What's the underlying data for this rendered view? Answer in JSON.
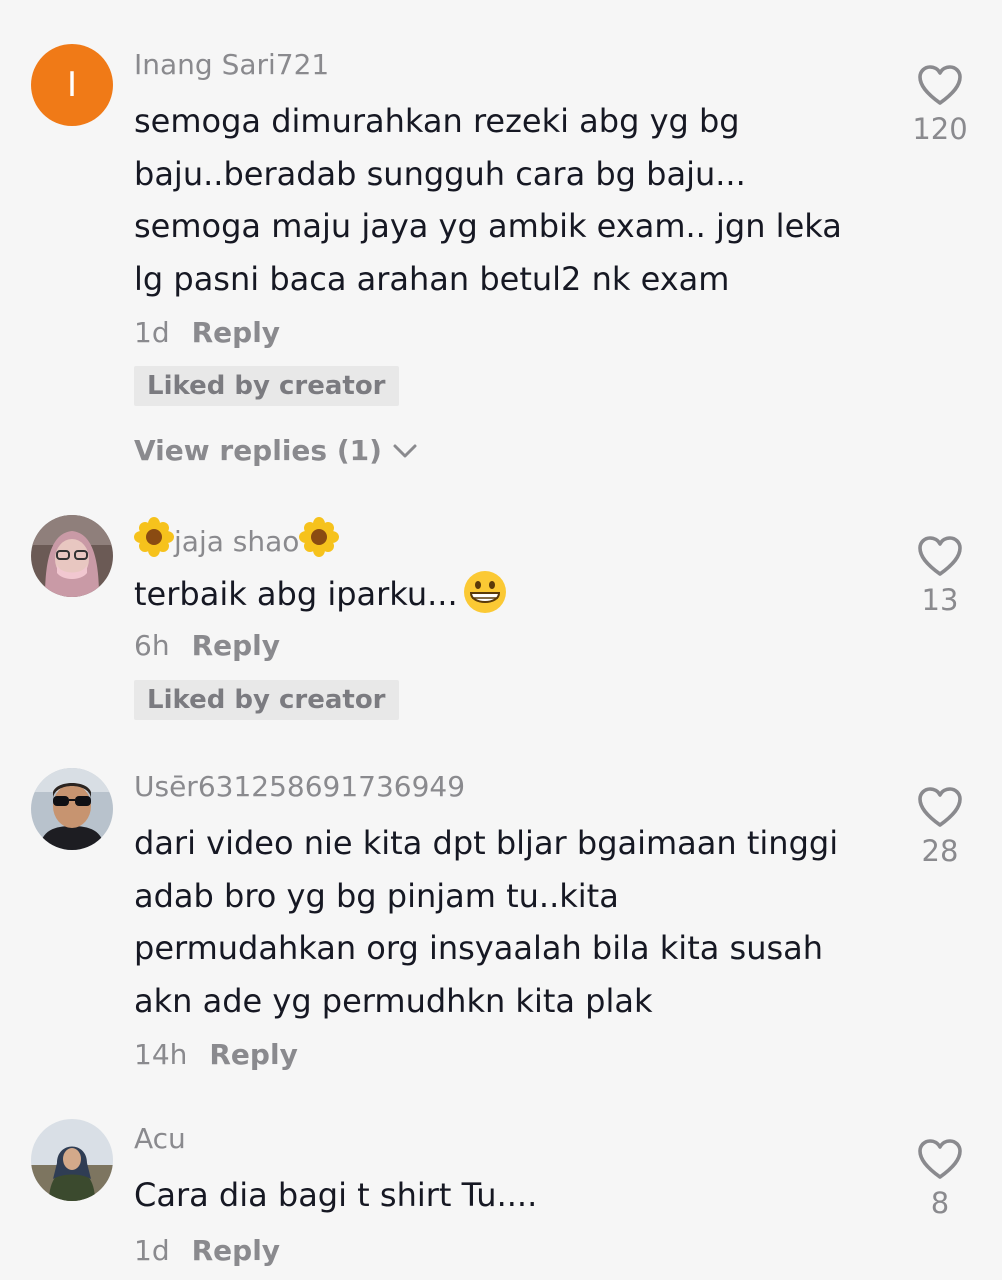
{
  "comments": [
    {
      "avatar_letter": "I",
      "avatar_color": "#f07a17",
      "username": "Inang Sari721",
      "lines": [
        "semoga dimurahkan rezeki abg yg bg",
        "baju..beradab sungguh cara bg baju...",
        "semoga maju jaya yg ambik exam.. jgn leka",
        "lg pasni baca arahan betul2 nk exam"
      ],
      "time": "1d",
      "reply_label": "Reply",
      "liked_by_creator": "Liked by creator",
      "view_replies": "View replies (1)",
      "like_count": "120"
    },
    {
      "username": "jaja shao",
      "username_decoration": "sunflower-emoji",
      "text": "terbaik abg iparku...",
      "text_emoji": "grinning-face-emoji",
      "time": "6h",
      "reply_label": "Reply",
      "liked_by_creator": "Liked by creator",
      "like_count": "13"
    },
    {
      "username": "Usēr631258691736949",
      "lines": [
        "dari video nie kita dpt bljar bgaimaan tinggi",
        "adab bro yg bg pinjam tu..kita",
        "permudahkan org insyaalah bila kita susah",
        "akn ade yg permudhkn kita plak"
      ],
      "time": "14h",
      "reply_label": "Reply",
      "like_count": "28"
    },
    {
      "username": "Acu",
      "text": "Cara dia bagi t shirt Tu....",
      "time": "1d",
      "reply_label": "Reply",
      "like_count": "8"
    }
  ],
  "colors": {
    "background": "#f6f6f6",
    "text": "#161823",
    "muted": "#8a8a8e",
    "liked_badge_bg": "#e8e8e8"
  },
  "icons": {
    "like": "heart-outline-icon",
    "expand": "chevron-down-icon"
  }
}
